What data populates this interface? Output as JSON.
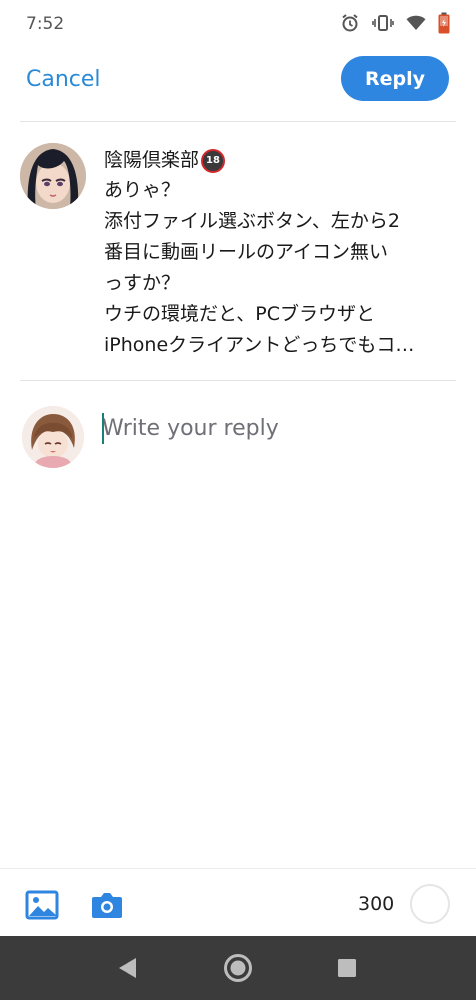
{
  "status_bar": {
    "time": "7:52",
    "icons": [
      "alarm-icon",
      "vibrate-icon",
      "wifi-icon",
      "battery-icon"
    ]
  },
  "header": {
    "cancel_label": "Cancel",
    "reply_label": "Reply"
  },
  "post": {
    "author": "陰陽倶楽部",
    "badge": "18",
    "lines": [
      "ありゃ？",
      "添付ファイル選ぶボタン、左から2",
      "番目に動画リールのアイコン無い",
      "っすか？",
      "ウチの環境だと、PCブラウザと",
      "iPhoneクライアントどっちでもコ…"
    ]
  },
  "composer": {
    "placeholder": "Write your reply"
  },
  "toolbar": {
    "icons": [
      "image-icon",
      "camera-icon"
    ],
    "char_count": "300"
  },
  "nav": {
    "icons": [
      "back-icon",
      "home-icon",
      "recents-icon"
    ]
  },
  "colors": {
    "accent": "#2f86e0",
    "link": "#2b8ad6",
    "caret": "#1b7f78",
    "nav_bg": "#3b3b3b"
  }
}
